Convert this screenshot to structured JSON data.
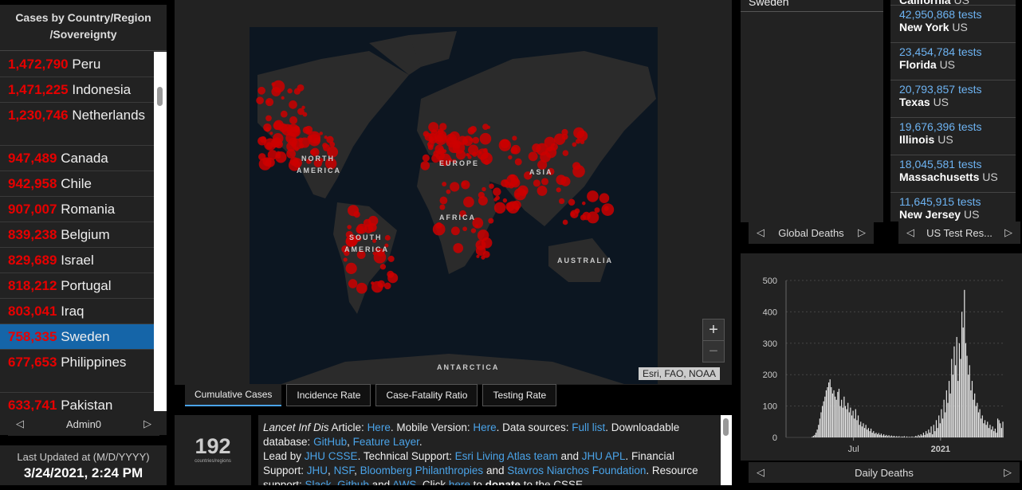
{
  "left": {
    "title_line1": "Cases by Country/Region",
    "title_line2": "/Sovereignty",
    "rows": [
      {
        "value": "1,472,790",
        "name": "Peru"
      },
      {
        "value": "1,471,225",
        "name": "Indonesia"
      },
      {
        "value": "1,230,746",
        "name": "Netherlands"
      },
      {
        "value": "947,489",
        "name": "Canada"
      },
      {
        "value": "942,958",
        "name": "Chile"
      },
      {
        "value": "907,007",
        "name": "Romania"
      },
      {
        "value": "839,238",
        "name": "Belgium"
      },
      {
        "value": "829,689",
        "name": "Israel"
      },
      {
        "value": "818,212",
        "name": "Portugal"
      },
      {
        "value": "803,041",
        "name": "Iraq"
      },
      {
        "value": "758,335",
        "name": "Sweden"
      },
      {
        "value": "677,653",
        "name": "Philippines"
      },
      {
        "value": "633,741",
        "name": "Pakistan"
      }
    ],
    "selected_index": 10,
    "pager_label": "Admin0",
    "updated_label": "Last Updated at (M/D/YYYY)",
    "updated_value": "3/24/2021, 2:24 PM"
  },
  "map": {
    "labels": {
      "north_america_1": "NORTH",
      "north_america_2": "AMERICA",
      "south_america_1": "SOUTH",
      "south_america_2": "AMERICA",
      "europe": "EUROPE",
      "asia": "ASIA",
      "africa": "AFRICA",
      "australia": "AUSTRALIA",
      "antarctica": "ANTARCTICA"
    },
    "attribution": "Esri, FAO, NOAA",
    "zoom_in": "+",
    "zoom_out": "−"
  },
  "tabs": [
    "Cumulative Cases",
    "Incidence Rate",
    "Case-Fatality Ratio",
    "Testing Rate"
  ],
  "active_tab": 0,
  "count": {
    "value": "192",
    "label": "countries/regions"
  },
  "info": {
    "t1": "Lancet Inf Dis",
    "t2": " Article: ",
    "l_here1": "Here",
    "t3": ". Mobile Version: ",
    "l_here2": "Here",
    "t4": ". Data sources: ",
    "l_full": "Full list",
    "t5": ". Downloadable database: ",
    "l_github": "GitHub",
    "t6": ", ",
    "l_feature": "Feature Layer",
    "t7": ".",
    "t8": "Lead by ",
    "l_jhu": "JHU CSSE",
    "t9": ". Technical Support: ",
    "l_esri": "Esri Living Atlas team",
    "t10": " and ",
    "l_apl": "JHU APL",
    "t11": ". Financial Support: ",
    "l_jhu2": "JHU",
    "t12": ", ",
    "l_nsf": "NSF",
    "t13": ", ",
    "l_bloom": "Bloomberg Philanthropies",
    "t14": " and ",
    "l_stav": "Stavros Niarchos",
    "l_found": "Foundation",
    "t15": ". Resource support: ",
    "l_slack": "Slack",
    "t16": ", ",
    "l_github2": "Github",
    "t17": " and ",
    "l_aws": "AWS",
    "t18": ". Click ",
    "l_here3": "here",
    "t19": " to ",
    "t20": "donate",
    "t21": " to the CSSE"
  },
  "deaths": {
    "header": "Sweden",
    "pager_label": "Global Deaths"
  },
  "tests": {
    "top_partial": {
      "place": "California",
      "country": "US"
    },
    "rows": [
      {
        "tests": "42,950,868 tests",
        "place": "New York",
        "country": "US"
      },
      {
        "tests": "23,454,784 tests",
        "place": "Florida",
        "country": "US"
      },
      {
        "tests": "20,793,857 tests",
        "place": "Texas",
        "country": "US"
      },
      {
        "tests": "19,676,396 tests",
        "place": "Illinois",
        "country": "US"
      },
      {
        "tests": "18,045,581 tests",
        "place": "Massachusetts",
        "country": "US"
      },
      {
        "tests": "11,645,915 tests",
        "place": "New Jersey",
        "country": "US"
      }
    ],
    "pager_label": "US Test Res..."
  },
  "colors": {
    "accent": "#4aa3e8",
    "case_red": "#e60000",
    "selected": "#1565a8"
  },
  "chart_data": {
    "type": "bar",
    "title": "Daily Deaths",
    "xlabel": "",
    "ylabel": "",
    "ylim": [
      0,
      500
    ],
    "y_ticks": [
      "0",
      "100",
      "200",
      "300",
      "400",
      "500"
    ],
    "x_tick_labels": [
      "Jul",
      "2021"
    ],
    "x_tick_positions": [
      0.31,
      0.71
    ],
    "values": [
      0,
      0,
      0,
      0,
      0,
      0,
      0,
      0,
      0,
      0,
      0,
      0,
      0,
      0,
      0,
      0,
      0,
      0,
      0,
      0,
      2,
      5,
      8,
      15,
      25,
      40,
      60,
      80,
      100,
      115,
      130,
      150,
      160,
      175,
      185,
      160,
      140,
      150,
      130,
      120,
      145,
      155,
      100,
      120,
      95,
      130,
      100,
      90,
      110,
      80,
      95,
      70,
      85,
      60,
      90,
      55,
      70,
      40,
      50,
      35,
      45,
      30,
      40,
      25,
      30,
      20,
      28,
      15,
      20,
      12,
      15,
      10,
      14,
      8,
      12,
      6,
      10,
      5,
      8,
      4,
      7,
      3,
      6,
      3,
      5,
      2,
      4,
      2,
      4,
      1,
      3,
      2,
      4,
      1,
      3,
      1,
      2,
      1,
      3,
      1,
      2,
      5,
      3,
      8,
      4,
      10,
      6,
      15,
      8,
      20,
      12,
      25,
      15,
      35,
      10,
      40,
      20,
      55,
      30,
      70,
      45,
      90,
      60,
      120,
      80,
      150,
      110,
      180,
      140,
      250,
      200,
      290,
      230,
      320,
      180,
      300,
      250,
      400,
      350,
      470,
      300,
      260,
      200,
      230,
      150,
      180,
      120,
      140,
      100,
      110,
      80,
      90,
      60,
      70,
      45,
      55,
      40,
      50,
      30,
      40,
      25,
      35,
      20,
      28,
      15,
      60,
      55,
      45,
      30,
      50
    ]
  }
}
